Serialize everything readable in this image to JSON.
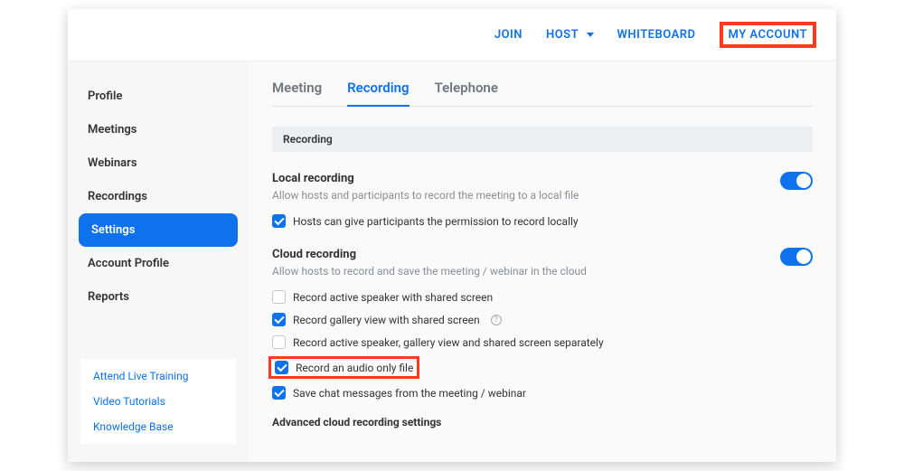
{
  "topnav": {
    "join": "JOIN",
    "host": "HOST",
    "whiteboard": "WHITEBOARD",
    "my_account": "MY ACCOUNT"
  },
  "sidebar": {
    "items": [
      {
        "label": "Profile"
      },
      {
        "label": "Meetings"
      },
      {
        "label": "Webinars"
      },
      {
        "label": "Recordings"
      },
      {
        "label": "Settings"
      },
      {
        "label": "Account Profile"
      },
      {
        "label": "Reports"
      }
    ],
    "links": {
      "training": "Attend Live Training",
      "tutorials": "Video Tutorials",
      "kb": "Knowledge Base"
    }
  },
  "tabs": {
    "meeting": "Meeting",
    "recording": "Recording",
    "telephone": "Telephone"
  },
  "section_bar": "Recording",
  "local": {
    "title": "Local recording",
    "desc": "Allow hosts and participants to record the meeting to a local file",
    "opt1": "Hosts can give participants the permission to record locally"
  },
  "cloud": {
    "title": "Cloud recording",
    "desc": "Allow hosts to record and save the meeting / webinar in the cloud",
    "opt1": "Record active speaker with shared screen",
    "opt2": "Record gallery view with shared screen",
    "opt3": "Record active speaker, gallery view and shared screen separately",
    "opt4": "Record an audio only file",
    "opt5": "Save chat messages from the meeting / webinar",
    "adv": "Advanced cloud recording settings"
  }
}
